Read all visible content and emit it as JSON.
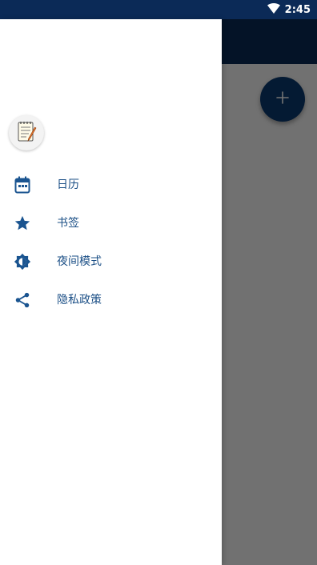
{
  "status_bar": {
    "time": "2:45",
    "icons": [
      "wifi-icon"
    ]
  },
  "fab": {
    "label": "+",
    "icon": "add-icon"
  },
  "drawer": {
    "logo_icon": "notepad-logo-icon",
    "items": [
      {
        "label": "日历",
        "icon": "calendar-icon"
      },
      {
        "label": "书签",
        "icon": "star-icon"
      },
      {
        "label": "夜间模式",
        "icon": "brightness-icon"
      },
      {
        "label": "隐私政策",
        "icon": "share-icon"
      }
    ]
  },
  "colors": {
    "primary_dark": "#0b2a57",
    "accent": "#0b3a72",
    "menu_text": "#1b4f86",
    "menu_icon": "#1a5490"
  }
}
